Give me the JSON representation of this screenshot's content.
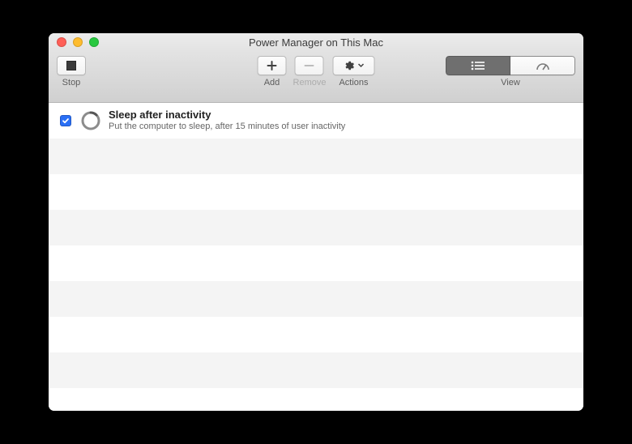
{
  "window": {
    "title": "Power Manager on This Mac"
  },
  "toolbar": {
    "stop_label": "Stop",
    "add_label": "Add",
    "remove_label": "Remove",
    "actions_label": "Actions",
    "view_label": "View"
  },
  "events": [
    {
      "enabled": true,
      "title": "Sleep after inactivity",
      "description": "Put the computer to sleep, after 15 minutes of user inactivity"
    }
  ]
}
